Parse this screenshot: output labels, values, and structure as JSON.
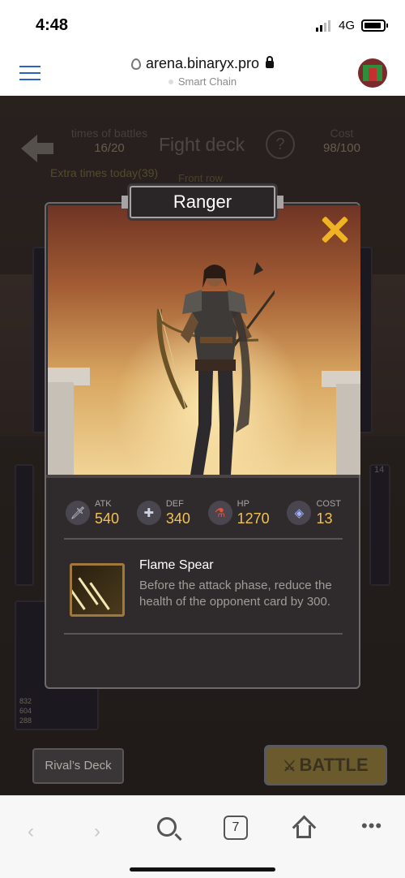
{
  "status_bar": {
    "time": "4:48",
    "network": "4G"
  },
  "browser": {
    "url": "arena.binaryx.pro",
    "subtitle": "Smart Chain"
  },
  "game": {
    "battles_label": "times of battles",
    "battles_value": "16/20",
    "extra_times": "Extra times today(39)",
    "title": "Fight deck",
    "help_symbol": "?",
    "cost_label": "Cost",
    "cost_value": "98/100",
    "front_row": "Front row",
    "rival_deck": "Rival’s Deck",
    "battle": "BATTLE",
    "bg_card_stats": [
      "832",
      "604",
      "288"
    ],
    "bg_card_level": "14"
  },
  "modal": {
    "name": "Ranger",
    "stats": [
      {
        "label": "ATK",
        "value": "540",
        "icon": "sword-icon"
      },
      {
        "label": "DEF",
        "value": "340",
        "icon": "shield-icon"
      },
      {
        "label": "HP",
        "value": "1270",
        "icon": "potion-icon"
      },
      {
        "label": "COST",
        "value": "13",
        "icon": "gem-icon"
      }
    ],
    "skill": {
      "name": "Flame Spear",
      "description": "Before the attack phase, reduce the health of the opponent card by 300."
    }
  },
  "navbar": {
    "tabs_count": "7"
  },
  "colors": {
    "accent_gold": "#f2c154",
    "close_orange": "#f0b323",
    "link_blue": "#2a62c8"
  }
}
